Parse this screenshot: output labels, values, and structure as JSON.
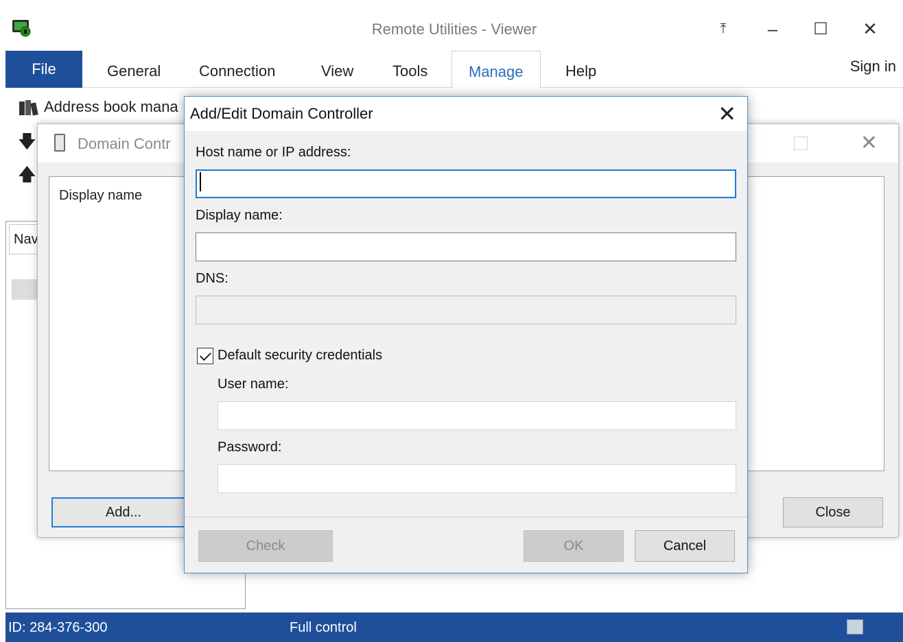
{
  "window": {
    "title": "Remote Utilities - Viewer",
    "min_glyph": "–",
    "max_glyph": "☐",
    "close_glyph": "✕",
    "pin_glyph": "⤒"
  },
  "ribbon": {
    "tabs": [
      {
        "label": "File"
      },
      {
        "label": "General"
      },
      {
        "label": "Connection"
      },
      {
        "label": "View"
      },
      {
        "label": "Tools"
      },
      {
        "label": "Manage"
      },
      {
        "label": "Help"
      }
    ],
    "active_tab": "Manage",
    "sign_in": "Sign in",
    "address_book_label": "Address book mana"
  },
  "sidebar": {
    "nav_tab": "Nav"
  },
  "domain_controllers_dialog": {
    "title": "Domain Contr",
    "list_header": "Display name",
    "add_button": "Add...",
    "close_button": "Close"
  },
  "add_edit_dialog": {
    "title": "Add/Edit Domain Controller",
    "host_label": "Host name or IP address:",
    "host_value": "",
    "display_label": "Display name:",
    "display_value": "",
    "dns_label": "DNS:",
    "dns_value": "",
    "default_credentials_label": "Default security credentials",
    "default_credentials_checked": true,
    "user_label": "User name:",
    "user_value": "",
    "password_label": "Password:",
    "password_value": "",
    "check_button": "Check",
    "ok_button": "OK",
    "cancel_button": "Cancel"
  },
  "statusbar": {
    "id": "ID: 284-376-300",
    "mode": "Full control"
  },
  "colors": {
    "accent": "#1f4f9a",
    "focus": "#1f7ad0",
    "active_tab_text": "#2a6db8"
  }
}
